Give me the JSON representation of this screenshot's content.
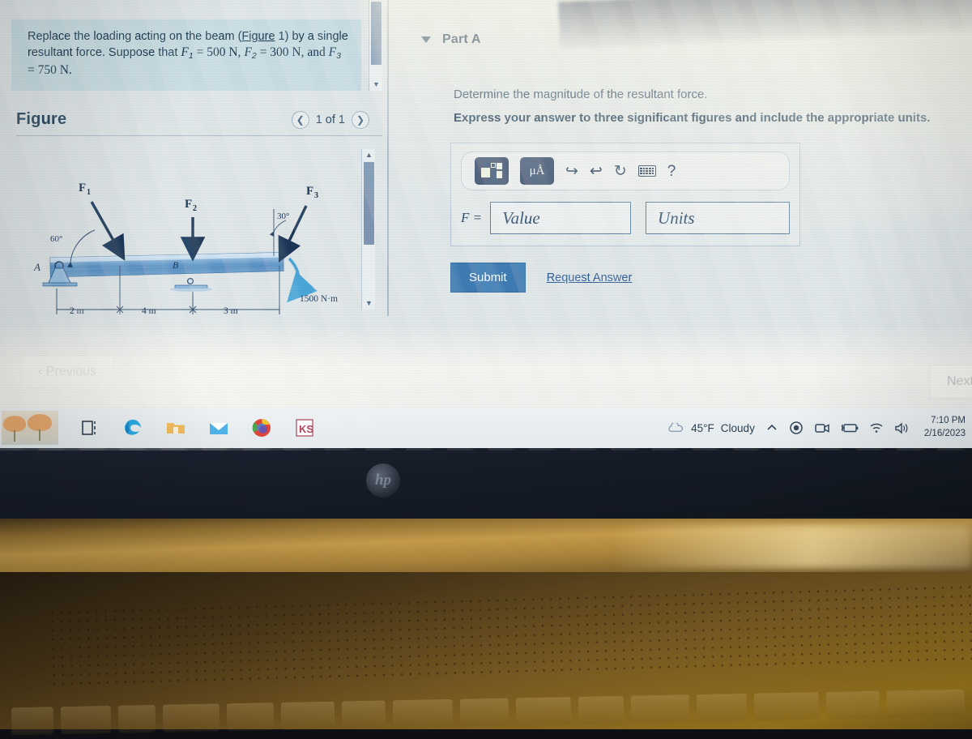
{
  "problem": {
    "text_part1": "Replace the loading acting on the beam (",
    "figure_link": "Figure 1",
    "text_part2": ") by a single resultant force. Suppose that ",
    "f1_sym": "F",
    "f1_sub": "1",
    "f1_eq": " = 500 N,",
    "f2_sym": "F",
    "f2_sub": "2",
    "f2_eq": " = 300 N, and ",
    "f3_sym": "F",
    "f3_sub": "3",
    "f3_eq": " = 750 N."
  },
  "figure": {
    "title": "Figure",
    "counter": "1 of 1",
    "prev_icon": "chevron-left-icon",
    "next_icon": "chevron-right-icon",
    "labels": {
      "support_a": "A",
      "point_b": "B",
      "f1": "F",
      "f1_sub": "1",
      "f2": "F",
      "f2_sub": "2",
      "f3": "F",
      "f3_sub": "3",
      "angle_f1": "60°",
      "angle_f3": "30°",
      "moment": "1500 N·m",
      "dim1": "2 m",
      "dim2": "4 m",
      "dim3": "3 m"
    }
  },
  "part": {
    "collapse_icon": "triangle-down-icon",
    "title": "Part A",
    "question": "Determine the magnitude of the resultant force.",
    "instruction": "Express your answer to three significant figures and include the appropriate units."
  },
  "answer": {
    "toolbar": {
      "template_icon": "math-template-icon",
      "units_label": "μÅ",
      "undo_icon": "undo-arrow-icon",
      "redo_icon": "redo-arrow-icon",
      "reset_icon": "reset-circular-arrow-icon",
      "keyboard_icon": "keyboard-icon",
      "help_label": "?"
    },
    "variable_label": "F =",
    "value_placeholder": "Value",
    "units_placeholder": "Units"
  },
  "actions": {
    "submit_label": "Submit",
    "request_answer_label": "Request Answer",
    "previous_label": "‹ Previous",
    "next_label": "Next"
  },
  "taskbar": {
    "widget_icon": "weather-widget-flowers",
    "apps": [
      {
        "name": "task-view-icon",
        "label": ""
      },
      {
        "name": "microsoft-edge-icon",
        "label": ""
      },
      {
        "name": "file-explorer-icon",
        "label": ""
      },
      {
        "name": "mail-icon",
        "label": ""
      },
      {
        "name": "google-chrome-icon",
        "label": ""
      },
      {
        "name": "wps-office-icon",
        "label": "KS"
      }
    ],
    "weather_temp": "45°F",
    "weather_cond": "Cloudy",
    "tray_icons": [
      "chevron-up-icon",
      "record-dot-icon",
      "camera-icon",
      "battery-icon",
      "wifi-icon",
      "volume-icon"
    ],
    "time": "7:10 PM",
    "date": "2/16/2023"
  },
  "hardware": {
    "brand_logo": "hp"
  },
  "colors": {
    "submit_blue": "#3f7cb4",
    "link_blue": "#2d5f99",
    "toolbar_dark": "#3e5273",
    "beam_blue": "#6f9fd0",
    "screen_bg": "#dfe6e8"
  }
}
